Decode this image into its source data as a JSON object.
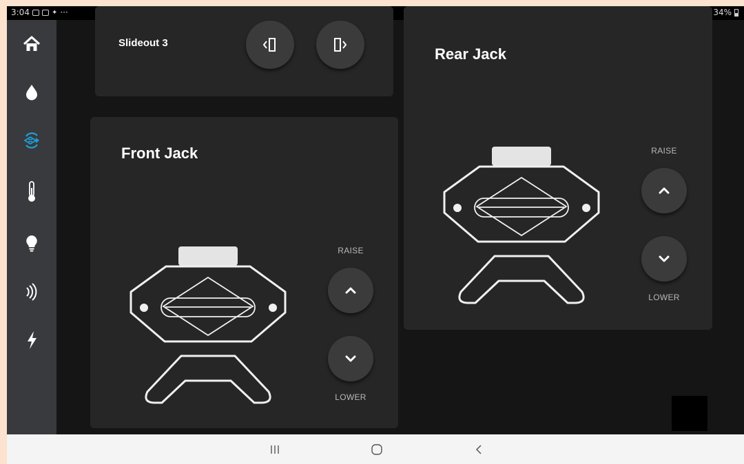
{
  "status_bar": {
    "time": "3:04",
    "overflow": "···",
    "battery": "34%",
    "left_icons": [
      "notification-icon",
      "gallery-icon",
      "dropbox-icon"
    ],
    "right_icons": [
      "mute-icon",
      "wifi-icon",
      "battery-icon"
    ]
  },
  "sidebar": {
    "items": [
      {
        "name": "home",
        "icon": "home-icon"
      },
      {
        "name": "water",
        "icon": "water-drop-icon"
      },
      {
        "name": "leveling",
        "icon": "leveling-icon",
        "active": true
      },
      {
        "name": "temperature",
        "icon": "thermometer-icon"
      },
      {
        "name": "lighting",
        "icon": "lightbulb-icon"
      },
      {
        "name": "signal",
        "icon": "signal-waves-icon"
      },
      {
        "name": "power",
        "icon": "lightning-icon"
      }
    ]
  },
  "slideout": {
    "title": "Slideout 3",
    "buttons": [
      {
        "name": "slideout-retract",
        "icon": "slide-in-icon"
      },
      {
        "name": "slideout-extend",
        "icon": "slide-out-icon"
      }
    ]
  },
  "front_jack": {
    "title": "Front Jack",
    "raise_label": "RAISE",
    "lower_label": "LOWER"
  },
  "rear_jack": {
    "title": "Rear Jack",
    "raise_label": "RAISE",
    "lower_label": "LOWER"
  },
  "colors": {
    "background": "#151515",
    "card": "#262626",
    "sidebar": "#383a3d",
    "active_icon": "#1e9fd8",
    "button": "#3b3b3b"
  },
  "nav_bar": {
    "buttons": [
      "recent-apps-icon",
      "home-circle-icon",
      "back-icon"
    ]
  }
}
